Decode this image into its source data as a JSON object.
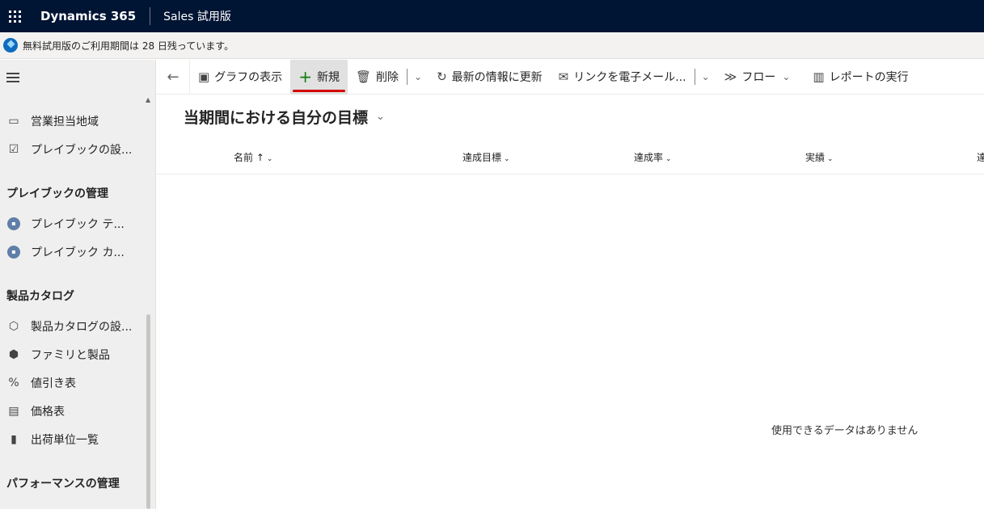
{
  "topbar": {
    "brand": "Dynamics 365",
    "app_name": "Sales 試用版"
  },
  "notice": {
    "text": "無料試用版のご利用期間は 28 日残っています。"
  },
  "sidebar": {
    "items_top": [
      {
        "label": "営業担当地域",
        "icon": "map-icon"
      },
      {
        "label": "プレイブックの設...",
        "icon": "checklist-icon"
      }
    ],
    "section_playbook": "プレイブックの管理",
    "items_playbook": [
      {
        "label": "プレイブック テ...",
        "icon": "playbook-template-icon"
      },
      {
        "label": "プレイブック カ...",
        "icon": "playbook-category-icon"
      }
    ],
    "section_catalog": "製品カタログ",
    "items_catalog": [
      {
        "label": "製品カタログの設...",
        "icon": "box-settings-icon"
      },
      {
        "label": "ファミリと製品",
        "icon": "cube-icon"
      },
      {
        "label": "値引き表",
        "icon": "percent-icon"
      },
      {
        "label": "価格表",
        "icon": "price-list-icon"
      },
      {
        "label": "出荷単位一覧",
        "icon": "units-icon"
      }
    ],
    "section_performance": "パフォーマンスの管理"
  },
  "commandbar": {
    "show_chart": "グラフの表示",
    "new": "新規",
    "delete": "削除",
    "refresh": "最新の情報に更新",
    "email_link": "リンクを電子メール...",
    "flow": "フロー",
    "run_report": "レポートの実行"
  },
  "view": {
    "title": "当期間における自分の目標"
  },
  "grid": {
    "columns": [
      "名前 ↑",
      "達成目標",
      "達成率",
      "実績",
      "達"
    ],
    "empty_message": "使用できるデータはありません"
  }
}
